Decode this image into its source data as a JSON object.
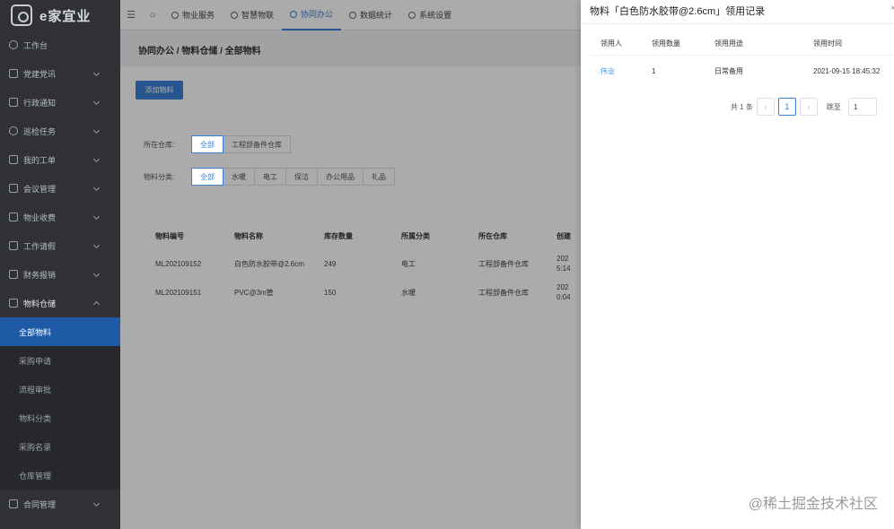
{
  "app": {
    "logo_text": "e家宜业"
  },
  "sidebar": {
    "items": [
      {
        "label": "工作台"
      },
      {
        "label": "党建党讯"
      },
      {
        "label": "行政通知"
      },
      {
        "label": "巡检任务"
      },
      {
        "label": "我的工单"
      },
      {
        "label": "会议管理"
      },
      {
        "label": "物业收费"
      },
      {
        "label": "工作请假"
      },
      {
        "label": "财务报销"
      },
      {
        "label": "物料仓储"
      }
    ],
    "sub_items": [
      {
        "label": "全部物料"
      },
      {
        "label": "采购申请"
      },
      {
        "label": "流程审批"
      },
      {
        "label": "物料分类"
      },
      {
        "label": "采购名录"
      },
      {
        "label": "仓库管理"
      }
    ],
    "last_item": {
      "label": "合同管理"
    }
  },
  "topbar": {
    "tabs": [
      {
        "label": "物业服务"
      },
      {
        "label": "智慧物联"
      },
      {
        "label": "协同办公"
      },
      {
        "label": "数据统计"
      },
      {
        "label": "系统设置"
      }
    ]
  },
  "page": {
    "breadcrumb": "协同办公 / 物料仓储 / 全部物料",
    "add_button": "添加物料",
    "warehouse_filter": {
      "label": "所在仓库:",
      "options": [
        "全部",
        "工程部备件仓库"
      ]
    },
    "category_filter": {
      "label": "物料分类:",
      "options": [
        "全部",
        "水暖",
        "电工",
        "保洁",
        "办公用品",
        "礼品"
      ]
    },
    "table": {
      "headers": [
        "物料编号",
        "物料名称",
        "库存数量",
        "所属分类",
        "所在仓库",
        "创建"
      ],
      "rows": [
        {
          "code": "ML202109152",
          "name": "白色防水胶带@2.6cm",
          "stock": "249",
          "category": "电工",
          "warehouse": "工程部备件仓库",
          "created": "202\n5:14"
        },
        {
          "code": "ML202109151",
          "name": "PVC@3m管",
          "stock": "150",
          "category": "水暖",
          "warehouse": "工程部备件仓库",
          "created": "202\n0:04"
        }
      ]
    }
  },
  "drawer": {
    "title": "物料「白色防水胶带@2.6cm」领用记录",
    "close": "×",
    "headers": [
      "领用人",
      "领用数量",
      "领用用途",
      "领用时间"
    ],
    "rows": [
      {
        "user": "伟业",
        "qty": "1",
        "purpose": "日常备用",
        "time": "2021-09-15 18:45:32"
      }
    ],
    "pager": {
      "total": "共 1 条",
      "current": "1",
      "jump_label": "跳至",
      "jump_value": "1"
    }
  },
  "watermark": "@稀土掘金技术社区"
}
